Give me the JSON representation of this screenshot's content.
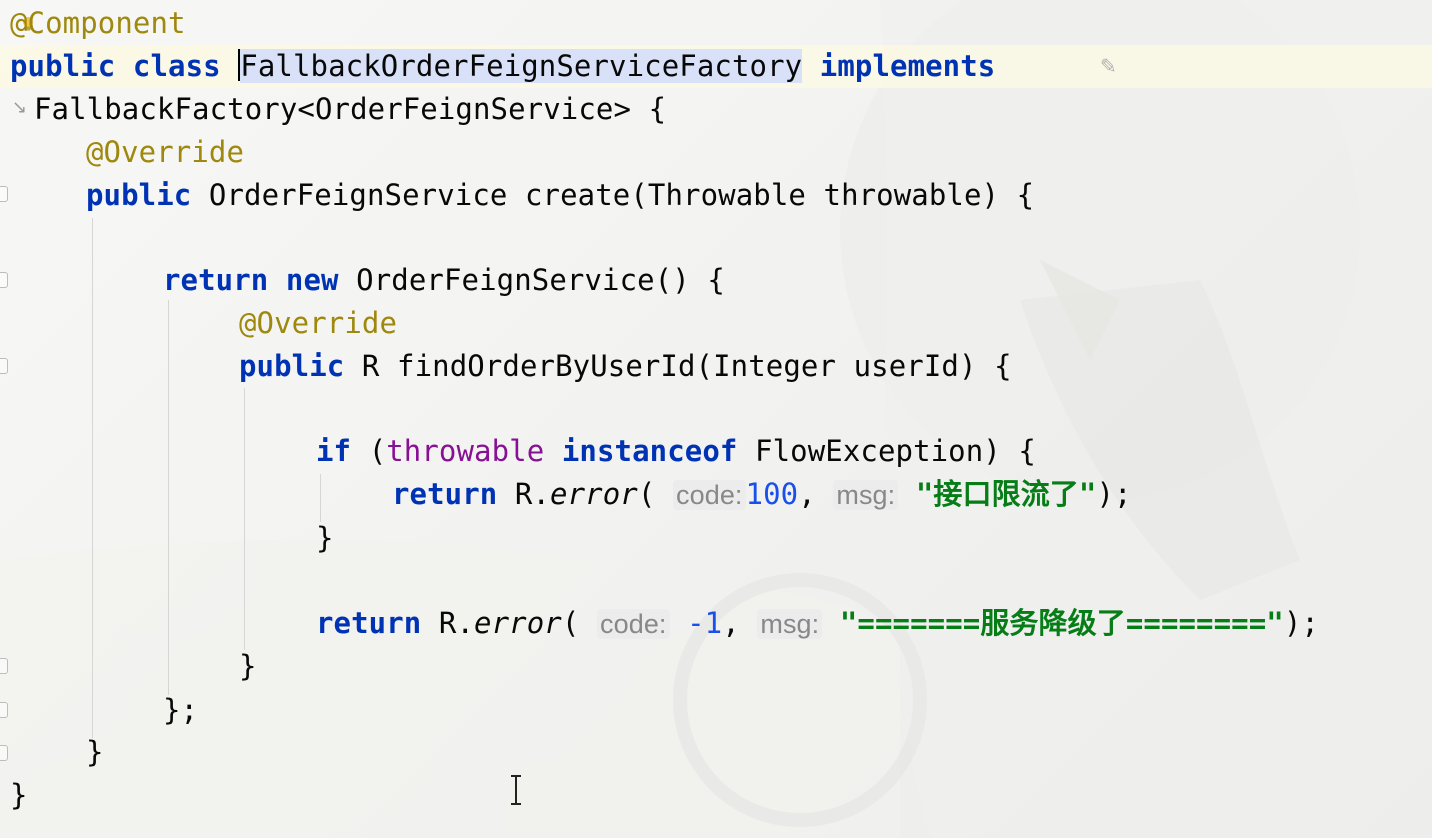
{
  "editor": {
    "language": "java",
    "lines": [
      {
        "annotation": "@Component"
      },
      {
        "kw1": "public",
        "kw2": "class",
        "class_name": "FallbackOrderFeignServiceFactory",
        "kw3": "implements"
      },
      {
        "text": "FallbackFactory<OrderFeignService> {"
      },
      {
        "annotation": "@Override"
      },
      {
        "kw": "public",
        "text": "OrderFeignService create(Throwable throwable) {"
      },
      {
        "text": ""
      },
      {
        "kw1": "return",
        "kw2": "new",
        "text": "OrderFeignService() {"
      },
      {
        "annotation": "@Override"
      },
      {
        "kw": "public",
        "text": "R findOrderByUserId(Integer userId) {"
      },
      {
        "text": ""
      },
      {
        "kw": "if",
        "open": "(",
        "field": "throwable",
        "kw2": "instanceof",
        "text": "FlowException) {"
      },
      {
        "kw": "return",
        "prefix": "R.",
        "method": "error",
        "open": "(",
        "hint1": "code:",
        "num": "100",
        "comma": ",",
        "hint2": "msg:",
        "string": "\"接口限流了\"",
        "close": ");"
      },
      {
        "text": "}"
      },
      {
        "text": ""
      },
      {
        "kw": "return",
        "prefix": "R.",
        "method": "error",
        "open": "(",
        "hint1": "code:",
        "num": "-1",
        "comma": ",",
        "hint2": "msg:",
        "string": "\"=======服务降级了========\"",
        "close": ");"
      },
      {
        "text": "}"
      },
      {
        "text": "};"
      },
      {
        "text": "}"
      },
      {
        "text": "}"
      }
    ],
    "colors": {
      "keyword": "#0033b3",
      "annotation": "#9e880d",
      "field": "#871094",
      "number": "#1750eb",
      "string": "#067d17",
      "hint": "#888888"
    },
    "icons": [
      "intention-bulb-icon",
      "soft-wrap-icon",
      "edit-icon",
      "text-cursor-icon"
    ]
  }
}
